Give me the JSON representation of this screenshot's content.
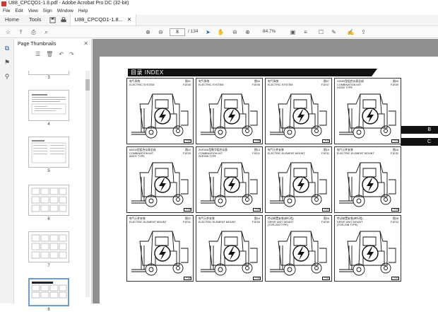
{
  "window": {
    "title": "U88_CPCQD1-1.8.pdf - Adobe Acrobat Pro DC (32-bit)"
  },
  "menu": [
    "File",
    "Edit",
    "View",
    "Sign",
    "Window",
    "Help"
  ],
  "tabs": {
    "home": "Home",
    "tools": "Tools",
    "doc": "U88_CPCQD1-1.8..."
  },
  "toolbar": {
    "page_current": "8",
    "page_total": "/ 134",
    "zoom": "84.7%"
  },
  "sidebar": {
    "panel_title": "Page Thumbnails",
    "thumbnails": [
      {
        "num": "3"
      },
      {
        "num": "4"
      },
      {
        "num": "5"
      },
      {
        "num": "6"
      },
      {
        "num": "7"
      },
      {
        "num": "8"
      }
    ]
  },
  "document": {
    "header": "目录   INDEX",
    "side_tabs": [
      "B",
      "C"
    ],
    "cells": [
      {
        "cap1": "电气系统",
        "cap2": "ELECTRIC SYSTEM",
        "cap3": "",
        "code1": "图01",
        "code2": "F1E05",
        "pg": "F01"
      },
      {
        "cap1": "电气系统",
        "cap2": "ELECTRIC SYSTEM",
        "cap3": "",
        "code1": "图04",
        "code2": "F1E05",
        "pg": "F05"
      },
      {
        "cap1": "电气系统",
        "cap2": "ELECTRIC SYSTEM",
        "cap3": "",
        "code1": "图07",
        "code2": "F1E07",
        "pg": "F11"
      },
      {
        "cap1": "H2000型组合仪表总成",
        "cap2": "COMBINATION M/T.",
        "cap3": "H2000 TYPE",
        "code1": "图09",
        "code2": "F1E09",
        "pg": "F15"
      },
      {
        "cap1": "6000A型组合仪表总成",
        "cap2": "COMBINATION M/T.",
        "cap3": "6000Y TYPE",
        "code1": "图10",
        "code2": "F1E09",
        "pg": "F16"
      },
      {
        "cap1": "ZKR30A型数字组合仪表",
        "cap2": "COMBINATION M/T.",
        "cap3": "ZKR30A TYPE",
        "code1": "图13",
        "code2": "F1E11",
        "pg": "F20"
      },
      {
        "cap1": "电气元件安装",
        "cap2": "ELECTRIC ELEMENT MOUNT",
        "cap3": "",
        "code1": "图15",
        "code2": "F1E31",
        "pg": "F21"
      },
      {
        "cap1": "电气元件安装",
        "cap2": "ELECTRIC ELEMENT MOUNT",
        "cap3": "",
        "code1": "图18",
        "code2": "F1E32",
        "pg": "F25"
      },
      {
        "cap1": "电气元件安装",
        "cap2": "ELECTRIC ELEMENT MOUNT",
        "cap3": "",
        "code1": "图22",
        "code2": "F1E31",
        "pg": "F30"
      },
      {
        "cap1": "电气元件安装",
        "cap2": "ELECTRIC ELEMENT MOUNT",
        "cap3": "",
        "code1": "图24",
        "code2": "F1E33",
        "pg": "F31"
      },
      {
        "cap1": "传动装置安装(单行程)",
        "cap2": "DRIVE UNIT MOUNT",
        "cap3": "(TOR-200 TYPE)",
        "code1": "图26",
        "code2": "F1E39",
        "pg": "F41"
      },
      {
        "cap1": "传动装置安装(单行程)",
        "cap2": "DRIVE UNIT MOUNT",
        "cap3": "(TOR-20B TYPE)",
        "code1": "图28",
        "code2": "F1E24",
        "pg": "F51"
      }
    ]
  }
}
